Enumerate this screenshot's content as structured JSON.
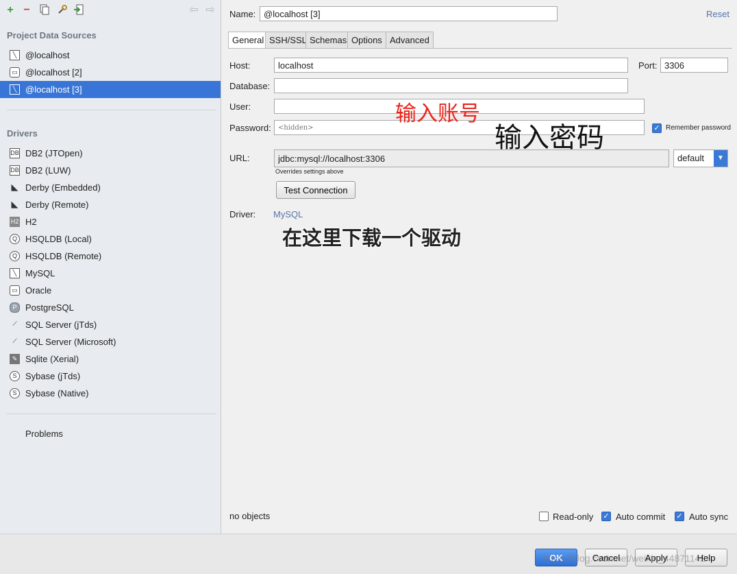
{
  "sidebar": {
    "toolbar_icons": [
      "add-icon",
      "remove-icon",
      "copy-icon",
      "properties-icon",
      "import-icon",
      "back-icon",
      "forward-icon"
    ],
    "project_title": "Project Data Sources",
    "data_sources": [
      {
        "label": "@localhost",
        "icon": "mysql-icon"
      },
      {
        "label": "@localhost [2]",
        "icon": "oracle-icon"
      },
      {
        "label": "@localhost [3]",
        "icon": "mysql-icon"
      }
    ],
    "drivers_title": "Drivers",
    "drivers": [
      {
        "label": "DB2 (JTOpen)",
        "icon": "db2-icon"
      },
      {
        "label": "DB2 (LUW)",
        "icon": "db2-icon"
      },
      {
        "label": "Derby (Embedded)",
        "icon": "derby-icon"
      },
      {
        "label": "Derby (Remote)",
        "icon": "derby-icon"
      },
      {
        "label": "H2",
        "icon": "h2-icon"
      },
      {
        "label": "HSQLDB (Local)",
        "icon": "hsqldb-icon"
      },
      {
        "label": "HSQLDB (Remote)",
        "icon": "hsqldb-icon"
      },
      {
        "label": "MySQL",
        "icon": "mysql-icon"
      },
      {
        "label": "Oracle",
        "icon": "oracle-icon"
      },
      {
        "label": "PostgreSQL",
        "icon": "postgresql-icon"
      },
      {
        "label": "SQL Server (jTds)",
        "icon": "sqlserver-icon"
      },
      {
        "label": "SQL Server (Microsoft)",
        "icon": "sqlserver-icon"
      },
      {
        "label": "Sqlite (Xerial)",
        "icon": "sqlite-icon"
      },
      {
        "label": "Sybase (jTds)",
        "icon": "sybase-icon"
      },
      {
        "label": "Sybase (Native)",
        "icon": "sybase-icon"
      }
    ],
    "problems_label": "Problems"
  },
  "form": {
    "name_label": "Name:",
    "name_value": "@localhost [3]",
    "reset_label": "Reset",
    "tabs": [
      "General",
      "SSH/SSL",
      "Schemas",
      "Options",
      "Advanced"
    ],
    "host_label": "Host:",
    "host_value": "localhost",
    "port_label": "Port:",
    "port_value": "3306",
    "database_label": "Database:",
    "database_value": "",
    "user_label": "User:",
    "user_value": "",
    "password_label": "Password:",
    "password_placeholder": "<hidden>",
    "remember_password_label": "Remember password",
    "url_label": "URL:",
    "url_value": "jdbc:mysql://localhost:3306",
    "url_hint": "Overrides settings above",
    "url_mode": "default",
    "test_connection_label": "Test Connection",
    "driver_label": "Driver:",
    "driver_value": "MySQL",
    "status_text": "no objects",
    "readonly_label": "Read-only",
    "autocommit_label": "Auto commit",
    "autosync_label": "Auto sync"
  },
  "annotations": {
    "account": "输入账号",
    "password": "输入密码",
    "driver": "在这里下载一个驱动"
  },
  "footer": {
    "ok_label": "OK",
    "cancel_label": "Cancel",
    "apply_label": "Apply",
    "help_label": "Help",
    "watermark": "https://blog.csdn.net/weixin_44871142"
  },
  "colors": {
    "selection": "#3875d7",
    "link": "#5676a8",
    "annotation_red": "#e8251c"
  }
}
